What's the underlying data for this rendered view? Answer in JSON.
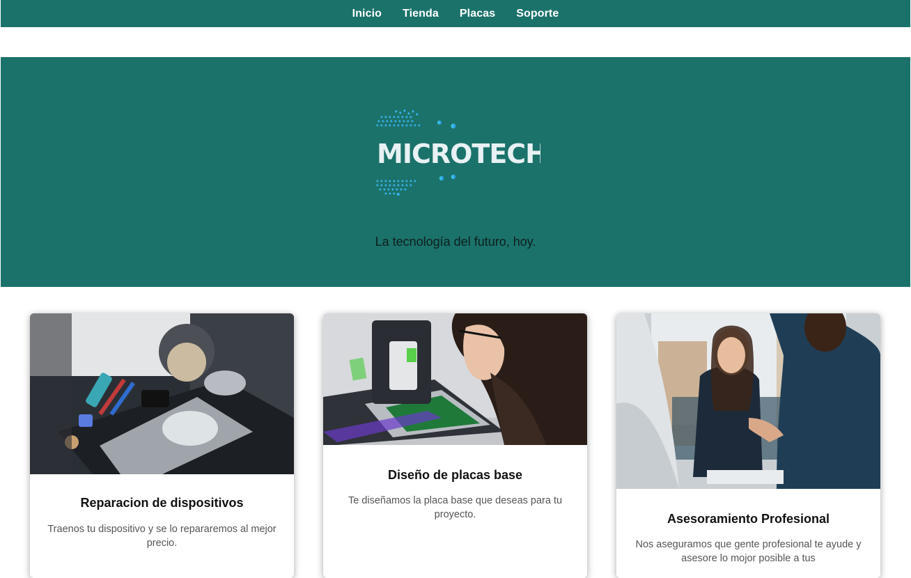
{
  "nav": {
    "items": [
      {
        "label": "Inicio"
      },
      {
        "label": "Tienda"
      },
      {
        "label": "Placas"
      },
      {
        "label": "Soporte"
      }
    ]
  },
  "hero": {
    "logo_text": "MICROTECH",
    "tagline": "La tecnología del futuro, hoy."
  },
  "cards": [
    {
      "title": "Reparacion de dispositivos",
      "text": "Traenos tu dispositivo y se lo repararemos al mejor precio."
    },
    {
      "title": "Diseño de placas base",
      "text": "Te diseñamos la placa base que deseas para tu proyecto."
    },
    {
      "title": "Asesoramiento Profesional",
      "text": "Nos aseguramos que gente profesional te ayude y asesore lo mojor posible a tus"
    }
  ],
  "colors": {
    "brand": "#1b726b",
    "logo_accent": "#2ec4e6"
  }
}
